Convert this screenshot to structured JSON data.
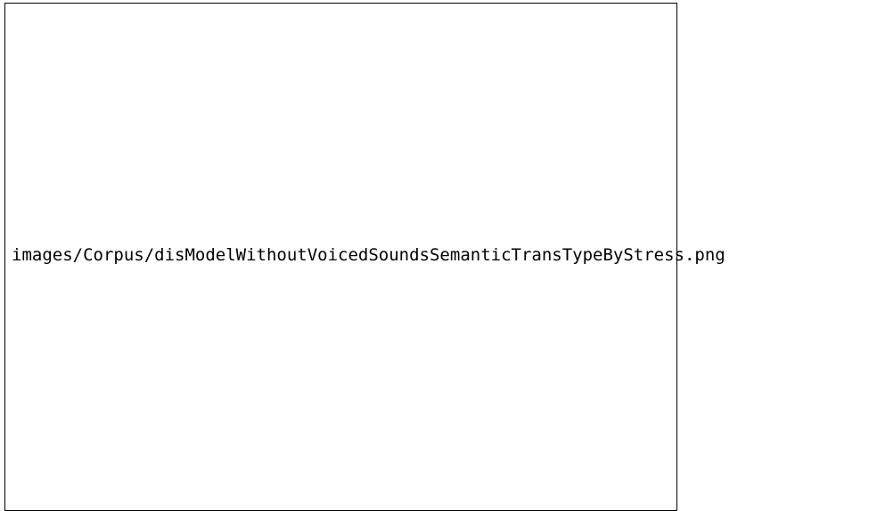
{
  "figure": {
    "missing_image_path": "images/Corpus/disModelWithoutVoicedSoundsSemanticTransTypeByStress.png"
  }
}
